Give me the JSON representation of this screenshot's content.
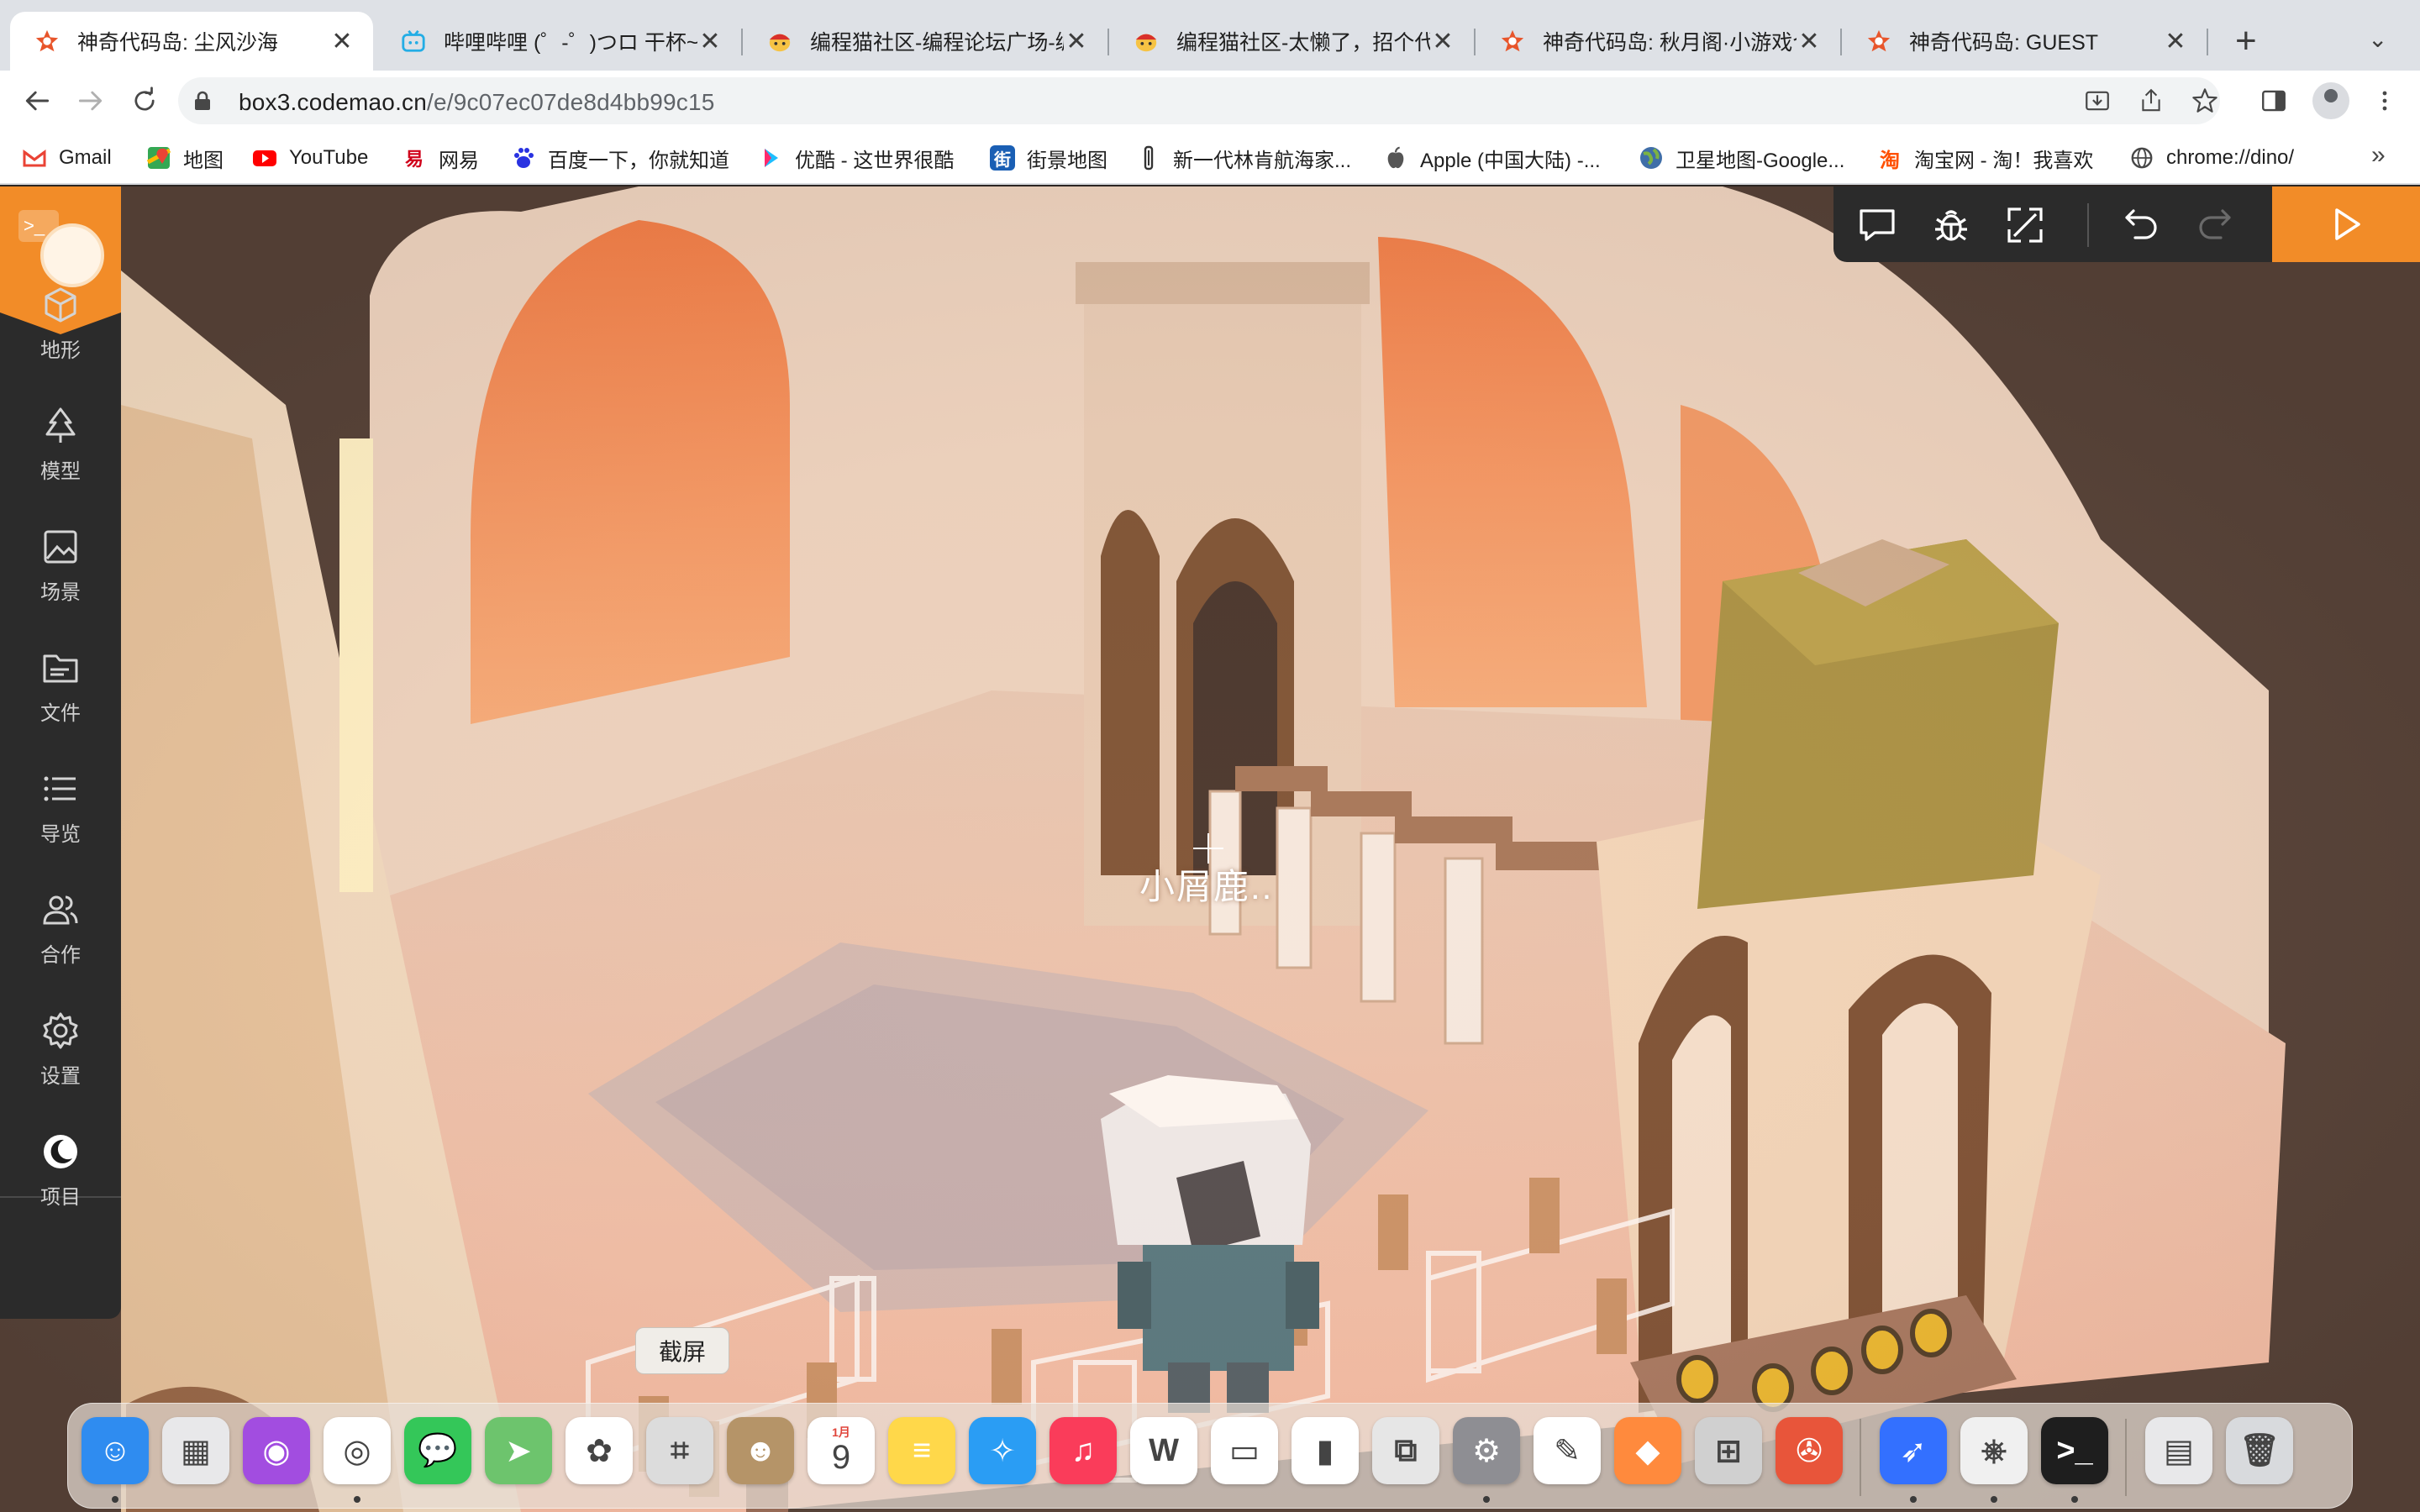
{
  "browser": {
    "tabs": [
      {
        "title": "神奇代码岛: 尘风沙海",
        "active": true,
        "icon": "codemao-icon"
      },
      {
        "title": "哔哩哔哩 (゜-゜)つロ 干杯~-",
        "active": false,
        "icon": "bilibili-icon"
      },
      {
        "title": "编程猫社区-编程论坛广场-编",
        "active": false,
        "icon": "bcm-icon"
      },
      {
        "title": "编程猫社区-太懒了，招个代",
        "active": false,
        "icon": "bcm-icon"
      },
      {
        "title": "神奇代码岛: 秋月阁·小游戏合",
        "active": false,
        "icon": "codemao-icon"
      },
      {
        "title": "神奇代码岛: GUEST",
        "active": false,
        "icon": "codemao-icon"
      }
    ],
    "close_glyph": "✕",
    "new_tab_glyph": "+",
    "tab_search_glyph": "⌄",
    "url_host": "box3.codemao.cn",
    "url_path": "/e/9c07ec07de8d4bb99c15",
    "bookmarks": [
      {
        "label": "Gmail",
        "icon": "gmail-icon"
      },
      {
        "label": "地图",
        "icon": "maps-icon"
      },
      {
        "label": "YouTube",
        "icon": "youtube-icon"
      },
      {
        "label": "网易",
        "icon": "netease-icon"
      },
      {
        "label": "百度一下，你就知道",
        "icon": "baidu-icon"
      },
      {
        "label": "优酷 - 这世界很酷",
        "icon": "youku-icon"
      },
      {
        "label": "街景地图",
        "icon": "streetview-icon"
      },
      {
        "label": "新一代林肯航海家...",
        "icon": "lincoln-icon"
      },
      {
        "label": "Apple (中国大陆) -...",
        "icon": "apple-icon"
      },
      {
        "label": "卫星地图-Google...",
        "icon": "globe-icon"
      },
      {
        "label": "淘宝网 - 淘！我喜欢",
        "icon": "taobao-icon"
      },
      {
        "label": "chrome://dino/",
        "icon": "chrome-globe-icon"
      }
    ],
    "bookmarks_more": "»"
  },
  "editor": {
    "logo_term": ">_",
    "sidebar": [
      {
        "label": "地形",
        "icon": "cube-icon"
      },
      {
        "label": "模型",
        "icon": "tree-icon"
      },
      {
        "label": "场景",
        "icon": "image-icon"
      },
      {
        "label": "文件",
        "icon": "folder-icon"
      },
      {
        "label": "导览",
        "icon": "list-icon"
      },
      {
        "label": "合作",
        "icon": "people-icon"
      },
      {
        "label": "设置",
        "icon": "gear-icon"
      },
      {
        "label": "项目",
        "icon": "moon-icon"
      }
    ],
    "topbar": [
      "chat-icon",
      "debug-icon",
      "fullscreen-icon",
      "undo-icon",
      "redo-icon",
      "play-icon"
    ],
    "player_name": "小屑鹿..",
    "tooltip": "截屏"
  },
  "dock": {
    "apps": [
      {
        "name": "finder-icon",
        "color": "#2f8cf0",
        "glyph": "☺",
        "running": true
      },
      {
        "name": "launchpad-icon",
        "color": "#e8e8ea",
        "glyph": "▦",
        "running": false
      },
      {
        "name": "podcasts-icon",
        "color": "#a24de0",
        "glyph": "◉",
        "running": false
      },
      {
        "name": "chrome-icon",
        "color": "#ffffff",
        "glyph": "◎",
        "running": true
      },
      {
        "name": "messages-icon",
        "color": "#34c759",
        "glyph": "💬",
        "running": false
      },
      {
        "name": "maps-icon",
        "color": "#6dc46d",
        "glyph": "➤",
        "running": false
      },
      {
        "name": "photos-icon",
        "color": "#ffffff",
        "glyph": "✿",
        "running": false
      },
      {
        "name": "screenshot-icon",
        "color": "#dcdcdc",
        "glyph": "⌗",
        "running": false
      },
      {
        "name": "contacts-icon",
        "color": "#b59468",
        "glyph": "☻",
        "running": false
      },
      {
        "name": "calendar-icon",
        "color": "#ffffff",
        "glyph": "9",
        "running": false
      },
      {
        "name": "notes-icon",
        "color": "#ffd84a",
        "glyph": "≡",
        "running": false
      },
      {
        "name": "safari-icon",
        "color": "#2a9df4",
        "glyph": "✧",
        "running": false
      },
      {
        "name": "music-icon",
        "color": "#fa3c5a",
        "glyph": "♫",
        "running": false
      },
      {
        "name": "wps-icon",
        "color": "#ffffff",
        "glyph": "W",
        "running": false
      },
      {
        "name": "keynote-icon",
        "color": "#ffffff",
        "glyph": "▭",
        "running": false
      },
      {
        "name": "numbers-icon",
        "color": "#ffffff",
        "glyph": "▮",
        "running": false
      },
      {
        "name": "screen-sharing-icon",
        "color": "#e6e6e6",
        "glyph": "⧉",
        "running": false
      },
      {
        "name": "system-preferences-icon",
        "color": "#8e8e93",
        "glyph": "⚙",
        "running": true
      },
      {
        "name": "pages-icon",
        "color": "#ffffff",
        "glyph": "✎",
        "running": false
      },
      {
        "name": "color-app-icon",
        "color": "#ff8a3d",
        "glyph": "◆",
        "running": false
      },
      {
        "name": "calculator-icon",
        "color": "#d0d0d0",
        "glyph": "⊞",
        "running": false
      },
      {
        "name": "compass-app-icon",
        "color": "#e8553a",
        "glyph": "✇",
        "running": false
      }
    ],
    "recent_apps": [
      {
        "name": "feishu-icon",
        "color": "#3370ff",
        "glyph": "➶",
        "running": true
      },
      {
        "name": "python-icon",
        "color": "#f0f0f0",
        "glyph": "⎈",
        "running": true
      },
      {
        "name": "terminal-icon",
        "color": "#1e1e1e",
        "glyph": ">_",
        "running": true
      }
    ],
    "other": [
      {
        "name": "screenshot-folder-icon",
        "color": "#e8e8ea",
        "glyph": "▤",
        "running": false
      },
      {
        "name": "trash-icon",
        "color": "#d8dadd",
        "glyph": "🗑",
        "running": false
      }
    ],
    "calendar_month": "1月"
  }
}
